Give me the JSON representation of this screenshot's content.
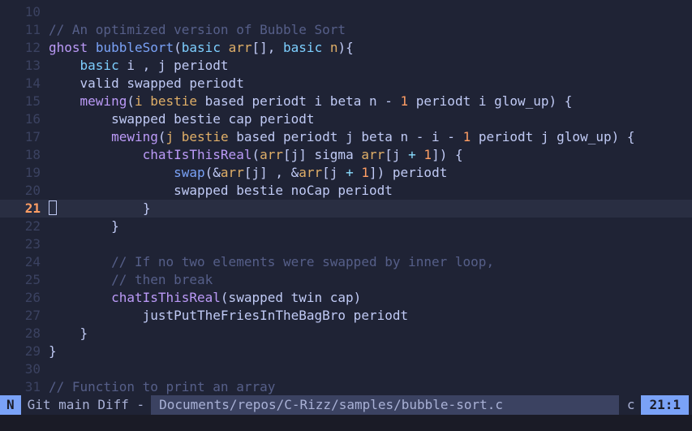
{
  "editor": {
    "current_line": 21,
    "lines": [
      {
        "num": "10",
        "tokens": []
      },
      {
        "num": "11",
        "tokens": [
          [
            "// An optimized version of Bubble Sort",
            "cm"
          ]
        ]
      },
      {
        "num": "12",
        "tokens": [
          [
            "ghost",
            "kw"
          ],
          [
            " ",
            "pl"
          ],
          [
            "bubbleSort",
            "fn"
          ],
          [
            "(",
            "pl"
          ],
          [
            "basic",
            "type"
          ],
          [
            " ",
            "pl"
          ],
          [
            "arr",
            "var"
          ],
          [
            "[], ",
            "pl"
          ],
          [
            "basic",
            "type"
          ],
          [
            " ",
            "pl"
          ],
          [
            "n",
            "var"
          ],
          [
            "){",
            "pl"
          ]
        ]
      },
      {
        "num": "13",
        "tokens": [
          [
            "    ",
            "pl"
          ],
          [
            "basic",
            "type"
          ],
          [
            " i , j periodt",
            "pl"
          ]
        ]
      },
      {
        "num": "14",
        "tokens": [
          [
            "    valid swapped periodt",
            "pl"
          ]
        ]
      },
      {
        "num": "15",
        "tokens": [
          [
            "    ",
            "pl"
          ],
          [
            "mewing",
            "kw"
          ],
          [
            "(",
            "pl"
          ],
          [
            "i",
            "var"
          ],
          [
            " ",
            "pl"
          ],
          [
            "bestie",
            "var"
          ],
          [
            " based periodt i beta n - ",
            "pl"
          ],
          [
            "1",
            "num"
          ],
          [
            " periodt i glow_up) {",
            "pl"
          ]
        ]
      },
      {
        "num": "16",
        "tokens": [
          [
            "        swapped bestie cap periodt",
            "pl"
          ]
        ]
      },
      {
        "num": "17",
        "tokens": [
          [
            "        ",
            "pl"
          ],
          [
            "mewing",
            "kw"
          ],
          [
            "(",
            "pl"
          ],
          [
            "j",
            "var"
          ],
          [
            " ",
            "pl"
          ],
          [
            "bestie",
            "var"
          ],
          [
            " based periodt j beta n - i - ",
            "pl"
          ],
          [
            "1",
            "num"
          ],
          [
            " periodt j glow_up) {",
            "pl"
          ]
        ]
      },
      {
        "num": "18",
        "tokens": [
          [
            "            ",
            "pl"
          ],
          [
            "chatIsThisReal",
            "kw"
          ],
          [
            "(",
            "pl"
          ],
          [
            "arr",
            "var"
          ],
          [
            "[j] sigma ",
            "pl"
          ],
          [
            "arr",
            "var"
          ],
          [
            "[j ",
            "pl"
          ],
          [
            "+",
            "op"
          ],
          [
            " ",
            "pl"
          ],
          [
            "1",
            "num"
          ],
          [
            "]) {",
            "pl"
          ]
        ]
      },
      {
        "num": "19",
        "tokens": [
          [
            "                ",
            "pl"
          ],
          [
            "swap",
            "fn"
          ],
          [
            "(&",
            "pl"
          ],
          [
            "arr",
            "var"
          ],
          [
            "[j] , &",
            "pl"
          ],
          [
            "arr",
            "var"
          ],
          [
            "[j ",
            "pl"
          ],
          [
            "+",
            "op"
          ],
          [
            " ",
            "pl"
          ],
          [
            "1",
            "num"
          ],
          [
            "]) periodt",
            "pl"
          ]
        ]
      },
      {
        "num": "20",
        "tokens": [
          [
            "                swapped bestie noCap periodt",
            "pl"
          ]
        ]
      },
      {
        "num": "21",
        "tokens": [
          [
            "            }",
            "pl"
          ]
        ]
      },
      {
        "num": "22",
        "tokens": [
          [
            "        }",
            "pl"
          ]
        ]
      },
      {
        "num": "23",
        "tokens": []
      },
      {
        "num": "24",
        "tokens": [
          [
            "        // If no two elements were swapped by inner loop,",
            "cm"
          ]
        ]
      },
      {
        "num": "25",
        "tokens": [
          [
            "        // then break",
            "cm"
          ]
        ]
      },
      {
        "num": "26",
        "tokens": [
          [
            "        ",
            "pl"
          ],
          [
            "chatIsThisReal",
            "kw"
          ],
          [
            "(swapped twin cap)",
            "pl"
          ]
        ]
      },
      {
        "num": "27",
        "tokens": [
          [
            "            justPutTheFriesInTheBagBro periodt",
            "pl"
          ]
        ]
      },
      {
        "num": "28",
        "tokens": [
          [
            "    }",
            "pl"
          ]
        ]
      },
      {
        "num": "29",
        "tokens": [
          [
            "}",
            "pl"
          ]
        ]
      },
      {
        "num": "30",
        "tokens": []
      },
      {
        "num": "31",
        "tokens": [
          [
            "// Function to print an array",
            "cm"
          ]
        ]
      }
    ]
  },
  "statusline": {
    "mode": "N",
    "git": "Git main Diff -",
    "filepath": "Documents/repos/C-Rizz/samples/bubble-sort.c",
    "filetype": "c",
    "position": "21:1"
  },
  "colors": {
    "background": "#1f2335",
    "current_line_bg": "#292e42",
    "accent": "#7aa2f7"
  }
}
